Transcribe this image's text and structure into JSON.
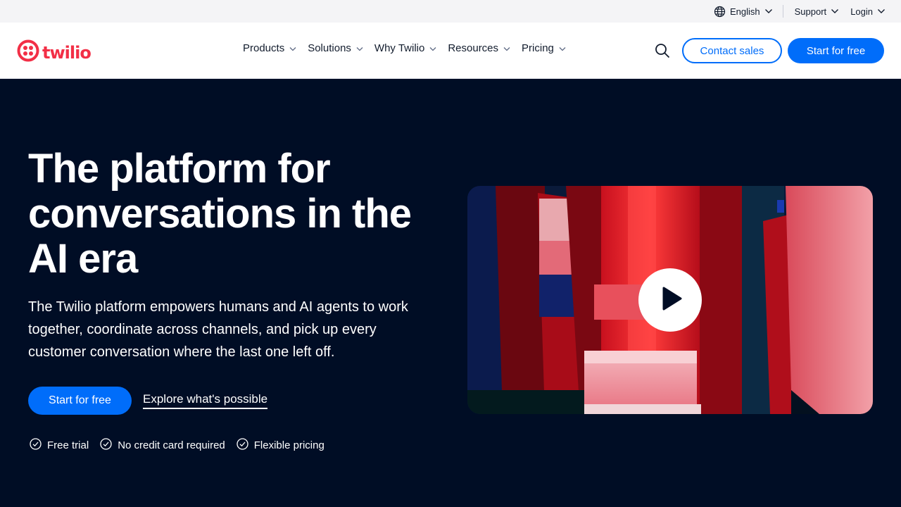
{
  "utility": {
    "language": "English",
    "support": "Support",
    "login": "Login"
  },
  "nav": {
    "logo_text": "twilio",
    "links": [
      "Products",
      "Solutions",
      "Why Twilio",
      "Resources",
      "Pricing"
    ],
    "contact_label": "Contact sales",
    "start_label": "Start for free"
  },
  "hero": {
    "title": "The platform for conversations in the AI era",
    "subtitle": "The Twilio platform empowers humans and AI agents to work together, coordinate across channels, and pick up every customer conversation where the last one left off.",
    "primary_cta": "Start for free",
    "secondary_cta": "Explore what's possible",
    "perks": [
      "Free trial",
      "No credit card required",
      "Flexible pricing"
    ]
  },
  "colors": {
    "brand_red": "#f22f46",
    "accent_blue": "#006dfa",
    "hero_bg": "#000d25"
  },
  "icons": {
    "language": "globe-icon",
    "dropdown": "chevron-down-icon",
    "search": "search-icon",
    "perk": "check-circle-icon",
    "play": "play-icon"
  }
}
